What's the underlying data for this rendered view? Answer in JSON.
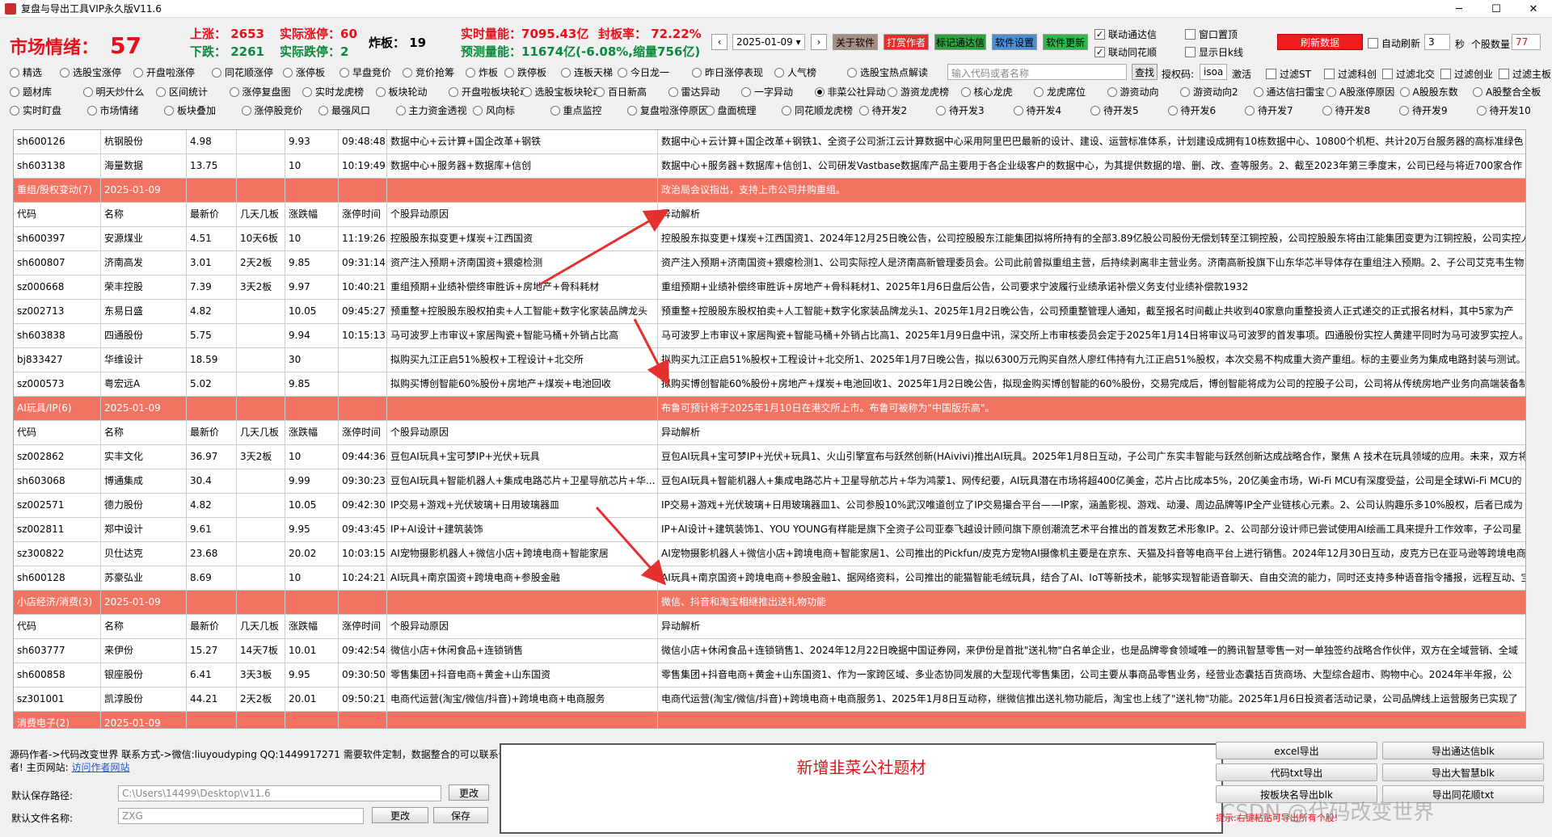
{
  "window": {
    "title": "复盘与导出工具VIP永久版V11.6"
  },
  "header": {
    "market_mood_label": "市场情绪：",
    "market_mood_value": "57",
    "up_count": "上涨：  2653",
    "actual_up": "实际涨停：60",
    "down_count": "下跌：  2261",
    "actual_down": "实际跌停：2",
    "broken": "炸板：  19",
    "realtime_volume": "实时量能：7095.43亿",
    "seal_rate": "封板率：  72.22%",
    "forecast_volume": "预测量能：11674亿(-6.08%,缩量756亿)",
    "date": "2025-01-09",
    "btn_about": "关于软件",
    "btn_reward": "打赏作者",
    "btn_mark": "标记通达信",
    "btn_settings": "软件设置",
    "btn_update": "软件更新",
    "cb_link_tdx": "联动通达信",
    "cb_link_ths": "联动同花顺",
    "cb_pin": "窗口置顶",
    "cb_showline": "显示日k线",
    "btn_refresh": "刷新数据",
    "cb_autorefresh": "自动刷新",
    "refresh_interval": "3",
    "refresh_unit": "秒",
    "stock_count_label": "个股数量",
    "stock_count": "77"
  },
  "radios_row1": [
    "精选",
    "选股宝涨停",
    "开盘啦涨停",
    "同花顺涨停",
    "涨停板",
    "早盘竞价",
    "竞价抢筹",
    "炸板",
    "跌停板",
    "连板天梯",
    "今日龙一",
    "昨日涨停表现",
    "人气榜",
    "选股宝热点解读"
  ],
  "radios_row2": [
    "题材库",
    "明天炒什么",
    "区间统计",
    "涨停复盘图",
    "实时龙虎榜",
    "板块轮动",
    "开盘啦板块轮动",
    "选股宝板块轮动",
    "百日新高",
    "雷达异动",
    "一字异动",
    "非菜公社异动",
    "游资龙虎榜",
    "核心龙虎",
    "龙虎席位",
    "游资动向",
    "游资动向2",
    "通达信扫雷宝",
    "A股涨停原因",
    "A股股东数",
    "A股整合全板"
  ],
  "radios_row3": [
    "实时盯盘",
    "市场情绪",
    "板块叠加",
    "涨停股竞价",
    "最强风口",
    "主力资金透视",
    "风向标",
    "重点监控",
    "复盘啦涨停原因",
    "盘面梳理",
    "同花顺龙虎榜",
    "待开发2",
    "待开发3",
    "待开发4",
    "待开发5",
    "待开发6",
    "待开发7",
    "待开发8",
    "待开发9",
    "待开发10"
  ],
  "search": {
    "placeholder": "输入代码或者名称",
    "btn": "查找",
    "auth_label": "授权码:",
    "auth_value": "isoa",
    "activate": "激活"
  },
  "filters": [
    "过滤ST",
    "过滤科创",
    "过滤北交",
    "过滤创业",
    "过滤主板"
  ],
  "table": {
    "rows": [
      {
        "type": "data",
        "cells": [
          "sh600126",
          "杭钢股份",
          "4.98",
          "",
          "9.93",
          "09:48:48",
          "数据中心+云计算+国企改革+钢铁",
          "数据中心+云计算+国企改革+钢铁1、全资子公司浙江云计算数据中心采用阿里巴巴最新的设计、建设、运营标准体系，计划建设成拥有10栋数据中心、10800个机柜、共计20万台服务器的高标准绿色"
        ]
      },
      {
        "type": "data",
        "cells": [
          "sh603138",
          "海量数据",
          "13.75",
          "",
          "10",
          "10:19:49",
          "数据中心+服务器+数据库+信创",
          "数据中心+服务器+数据库+信创1、公司研发Vastbase数据库产品主要用于各企业级客户的数据中心，为其提供数据的增、删、改、查等服务。2、截至2023年第三季度末，公司已经与将近700家合作"
        ]
      },
      {
        "type": "group",
        "cells": [
          "重组/股权变动(7)",
          "2025-01-09",
          "",
          "",
          "",
          "",
          "",
          "政治局会议指出，支持上市公司并购重组。"
        ]
      },
      {
        "type": "head",
        "cells": [
          "代码",
          "名称",
          "最新价",
          "几天几板",
          "涨跌幅",
          "涨停时间",
          "个股异动原因",
          "异动解析"
        ]
      },
      {
        "type": "data",
        "cells": [
          "sh600397",
          "安源煤业",
          "4.51",
          "10天6板",
          "10",
          "11:19:26",
          "控股股东拟变更+煤炭+江西国资",
          "控股股东拟变更+煤炭+江西国资1、2024年12月25日晚公告，公司控股股东江能集团拟将所持有的全部3.89亿股公司股份无偿划转至江铜控股，公司控股股东将由江能集团变更为江铜控股，公司实控人"
        ]
      },
      {
        "type": "data",
        "cells": [
          "sh600807",
          "济南高发",
          "3.01",
          "2天2板",
          "9.85",
          "09:31:14",
          "资产注入预期+济南国资+猥瘪检测",
          "资产注入预期+济南国资+猥瘪检测1、公司实际控人是济南高新管理委员会。公司此前曾拟重组主营，后持续剥离非主营业务。济南高新投旗下山东华芯半导体存在重组注入预期。2、子公司艾克韦生物已"
        ]
      },
      {
        "type": "data",
        "cells": [
          "sz000668",
          "荣丰控股",
          "7.39",
          "3天2板",
          "9.97",
          "10:40:21",
          "重组预期+业绩补偿终审胜诉+房地产+骨科耗材",
          "重组预期+业绩补偿终审胜诉+房地产+骨科耗材1、2025年1月6日盘后公告，公司要求宁波履行业绩承诺补偿义务支付业绩补偿款1932"
        ]
      },
      {
        "type": "data",
        "cells": [
          "sz002713",
          "东易日盛",
          "4.82",
          "",
          "10.05",
          "09:45:27",
          "预重整+控股股东股权拍卖+人工智能+数字化家装品牌龙头",
          "预重整+控股股东股权拍卖+人工智能+数字化家装品牌龙头1、2025年1月2日晚公告，公司预重整管理人通知，截至报名时间截止共收到40家意向重整投资人正式递交的正式报名材料，其中5家为产"
        ]
      },
      {
        "type": "data",
        "cells": [
          "sh603838",
          "四通股份",
          "5.75",
          "",
          "9.94",
          "10:15:13",
          "马可波罗上市审议+家居陶瓷+智能马桶+外销占比高",
          "马可波罗上市审议+家居陶瓷+智能马桶+外销占比高1、2025年1月9日盘中讯，深交所上市审核委员会定于2025年1月14日将审议马可波罗的首发事项。四通股份实控人黄建平同时为马可波罗实控人。2"
        ]
      },
      {
        "type": "data",
        "cells": [
          "bj833427",
          "华维设计",
          "18.59",
          "",
          "30",
          "",
          "拟购买九江正启51%股权+工程设计+北交所",
          "拟购买九江正启51%股权+工程设计+北交所1、2025年1月7日晚公告，拟以6300万元购买自然人廖红伟持有九江正启51%股权，本次交易不构成重大资产重组。标的主要业务为集成电路封装与测试。2"
        ]
      },
      {
        "type": "data",
        "cells": [
          "sz000573",
          "粤宏远A",
          "5.02",
          "",
          "9.85",
          "",
          "拟购买博创智能60%股份+房地产+煤炭+电池回收",
          "拟购买博创智能60%股份+房地产+煤炭+电池回收1、2025年1月2日晚公告，拟现金购买博创智能的60%股份，交易完成后，博创智能将成为公司的控股子公司，公司将从传统房地产业务向高端装备制"
        ]
      },
      {
        "type": "group",
        "cells": [
          "AI玩具/IP(6)",
          "2025-01-09",
          "",
          "",
          "",
          "",
          "",
          "布鲁可预计将于2025年1月10日在港交所上市。布鲁可被称为\"中国版乐高\"。"
        ]
      },
      {
        "type": "head",
        "cells": [
          "代码",
          "名称",
          "最新价",
          "几天几板",
          "涨跌幅",
          "涨停时间",
          "个股异动原因",
          "异动解析"
        ]
      },
      {
        "type": "data",
        "cells": [
          "sz002862",
          "实丰文化",
          "36.97",
          "3天2板",
          "10",
          "09:44:36",
          "豆包AI玩具+宝可梦IP+光伏+玩具",
          "豆包AI玩具+宝可梦IP+光伏+玩具1、火山引擎宣布与跃然创新(HAivivi)推出AI玩具。2025年1月8日互动，子公司广东实丰智能与跃然创新达成战略合作，聚焦 A 技术在玩具领域的应用。未来，双方将"
        ]
      },
      {
        "type": "data",
        "cells": [
          "sh603068",
          "博通集成",
          "30.4",
          "",
          "9.99",
          "09:30:23",
          "豆包AI玩具+智能机器人+集成电路芯片+卫星导航芯片+华...",
          "豆包AI玩具+智能机器人+集成电路芯片+卫星导航芯片+华为鸿蒙1、网传纪要，AI玩具潜在市场将超400亿美金，芯片占比成本5%，20亿美金市场，Wi-Fi MCU有深度受益，公司是全球Wi-Fi MCU的"
        ]
      },
      {
        "type": "data",
        "cells": [
          "sz002571",
          "德力股份",
          "4.82",
          "",
          "10.05",
          "09:42:30",
          "IP交易+游戏+光伏玻璃+日用玻璃器皿",
          "IP交易+游戏+光伏玻璃+日用玻璃器皿1、公司参股10%武汉唯道创立了IP交易撮合平台——IP家，涵盖影视、游戏、动漫、周边品牌等IP全产业链核心元素。2、公司认购趣乐多10%股权，后者已成为"
        ]
      },
      {
        "type": "data",
        "cells": [
          "sz002811",
          "郑中设计",
          "9.61",
          "",
          "9.95",
          "09:43:45",
          "IP+AI设计+建筑装饰",
          "IP+AI设计+建筑装饰1、YOU YOUNG有样能是旗下全资子公司亚泰飞越设计顾问旗下原创潮流艺术平台推出的首发数艺术形象IP。2、公司部分设计师已尝试使用AI绘画工具来提升工作效率，子公司星"
        ]
      },
      {
        "type": "data",
        "cells": [
          "sz300822",
          "贝仕达克",
          "23.68",
          "",
          "20.02",
          "10:03:15",
          "AI宠物摄影机器人+微信小店+跨境电商+智能家居",
          "AI宠物摄影机器人+微信小店+跨境电商+智能家居1、公司推出的Pickfun/皮克方宠物AI摄像机主要是在京东、天猫及抖音等电商平台上进行销售。2024年12月30日互动，皮克方已在亚马逊等跨境电商平台"
        ]
      },
      {
        "type": "data",
        "cells": [
          "sh600128",
          "苏豪弘业",
          "8.69",
          "",
          "10",
          "10:24:21",
          "AI玩具+南京国资+跨境电商+参股金融",
          "AI玩具+南京国资+跨境电商+参股金融1、据网络资料，公司推出的能猫智能毛绒玩具，结合了AI、IoT等新技术，能够实现智能语音聊天、自由交流的能力，同时还支持多种语音指令播报，远程互动、宝"
        ]
      },
      {
        "type": "group",
        "cells": [
          "小店经济/消费(3)",
          "2025-01-09",
          "",
          "",
          "",
          "",
          "",
          "微信、抖音和淘宝相继推出送礼物功能"
        ]
      },
      {
        "type": "head",
        "cells": [
          "代码",
          "名称",
          "最新价",
          "几天几板",
          "涨跌幅",
          "涨停时间",
          "个股异动原因",
          "异动解析"
        ]
      },
      {
        "type": "data",
        "cells": [
          "sh603777",
          "来伊份",
          "15.27",
          "14天7板",
          "10.01",
          "09:42:54",
          "微信小店+休闲食品+连锁销售",
          "微信小店+休闲食品+连锁销售1、2024年12月22日晚据中国证券网，来伊份是首批\"送礼物\"白名单企业，也是品牌零食领域唯一的腾讯智慧零售一对一单独签约战略合作伙伴，双方在全域营销、全域"
        ]
      },
      {
        "type": "data",
        "cells": [
          "sh600858",
          "银座股份",
          "6.41",
          "3天3板",
          "9.95",
          "09:30:50",
          "零售集团+抖音电商+黄金+山东国资",
          "零售集团+抖音电商+黄金+山东国资1、作为一家跨区域、多业态协同发展的大型现代零售集团，公司主要从事商品零售业务，经营业态囊括百货商场、大型综合超市、购物中心。2024年半年报，公"
        ]
      },
      {
        "type": "data",
        "cells": [
          "sz301001",
          "凯淳股份",
          "44.21",
          "2天2板",
          "20.01",
          "09:50:21",
          "电商代运营(淘宝/微信/抖音)+跨境电商+电商服务",
          "电商代运营(淘宝/微信/抖音)+跨境电商+电商服务1、2025年1月8日互动称，继微信推出送礼物功能后，淘宝也上线了\"送礼物\"功能。2025年1月6日投资者活动记录，公司品牌线上运营服务已实现了"
        ]
      },
      {
        "type": "group",
        "cells": [
          "消费电子(2)",
          "2025-01-09",
          "",
          "",
          "",
          "",
          "",
          ""
        ]
      }
    ]
  },
  "bottom": {
    "author_line1": "源码作者->代码改变世界  联系方式->微信:liuyoudyping QQ:1449917271 需要软件定制，数据整合的可以联系作",
    "author_line2": "者! 主页网站: ",
    "author_link": "访问作者网站",
    "save_path_label": "默认保存路径:",
    "save_path_value": "C:\\Users\\14499\\Desktop\\v11.6",
    "save_path_btn": "更改",
    "file_name_label": "默认文件名称:",
    "file_name_value": "ZXG",
    "file_name_btn": "更改",
    "save_btn": "保存",
    "notice": "新增韭菜公社题材",
    "export_buttons": [
      "excel导出",
      "导出通达信blk",
      "代码txt导出",
      "导出大智慧blk",
      "按板块名导出blk",
      "导出同花顺txt"
    ],
    "tip": "提示:右键粘贴可导出所有个股!",
    "watermark": "CSDN @代码改变世界"
  },
  "colors": {
    "group_row": "#f27362",
    "accent_red": "#e8101a",
    "accent_green": "#0a8a3a"
  }
}
